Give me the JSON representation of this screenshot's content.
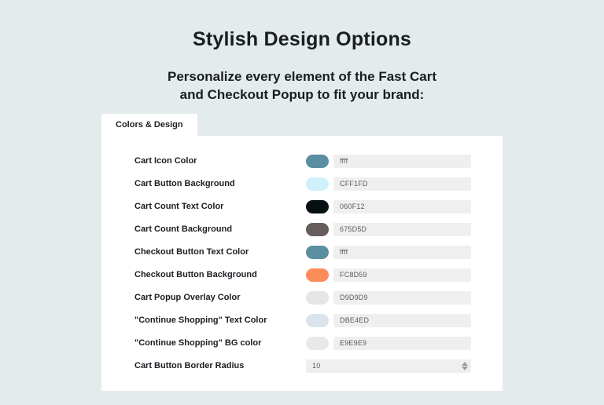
{
  "header": {
    "title": "Stylish Design Options",
    "subtitle_line1": "Personalize every element of the Fast Cart",
    "subtitle_line2": "and Checkout Popup to fit your brand:"
  },
  "tab": {
    "label": "Colors & Design"
  },
  "rows": [
    {
      "label": "Cart Icon Color",
      "value": "ffff",
      "swatch": "#5B8EA0"
    },
    {
      "label": "Cart Button Background",
      "value": "CFF1FD",
      "swatch": "#CFF1FD"
    },
    {
      "label": "Cart Count Text Color",
      "value": "060F12",
      "swatch": "#060F12"
    },
    {
      "label": "Cart Count Background",
      "value": "675D5D",
      "swatch": "#675D5D"
    },
    {
      "label": "Checkout Button Text Color",
      "value": "ffff",
      "swatch": "#5B8EA0"
    },
    {
      "label": "Checkout Button Background",
      "value": "FC8D59",
      "swatch": "#FC8D59"
    },
    {
      "label": "Cart Popup Overlay Color",
      "value": "D9D9D9",
      "swatch": "#E6E6E6"
    },
    {
      "label": "\"Continue Shopping\" Text Color",
      "value": "DBE4ED",
      "swatch": "#DBE4ED"
    },
    {
      "label": "\"Continue Shopping\" BG color",
      "value": "E9E9E9",
      "swatch": "#E9E9E9"
    }
  ],
  "number": {
    "label": "Cart Button Border Radius",
    "value": "10"
  }
}
